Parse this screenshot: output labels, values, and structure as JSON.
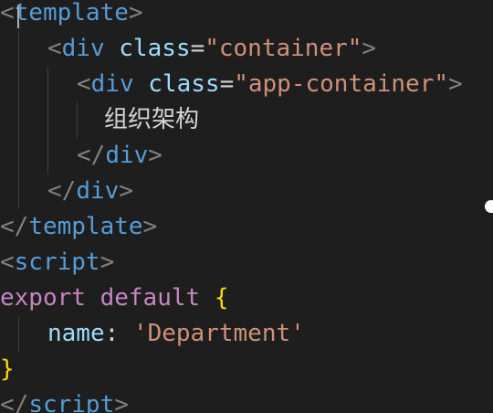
{
  "code": {
    "line0": {
      "open": "<",
      "tag": "template",
      "close": ">"
    },
    "line1": {
      "open": "<",
      "tag": "div",
      "space": " ",
      "attr": "class",
      "eq": "=",
      "value": "\"container\"",
      "close": ">"
    },
    "line2": {
      "open": "<",
      "tag": "div",
      "space": " ",
      "attr": "class",
      "eq": "=",
      "value": "\"app-container\"",
      "close": ">"
    },
    "line3": {
      "text": "组织架构"
    },
    "line4": {
      "open": "</",
      "tag": "div",
      "close": ">"
    },
    "line5": {
      "open": "</",
      "tag": "div",
      "close": ">"
    },
    "line6": {
      "open": "</",
      "tag": "template",
      "close": ">"
    },
    "line7": {
      "open": "<",
      "tag": "script",
      "close": ">"
    },
    "line8": {
      "kw1": "export",
      "space": " ",
      "kw2": "default",
      "space2": " ",
      "brace": "{"
    },
    "line9": {
      "prop": "name",
      "colon": ": ",
      "value": "'Department'"
    },
    "line10": {
      "brace": "}"
    },
    "line11": {
      "open": "</",
      "tag": "script",
      "close": ">"
    }
  },
  "colors": {
    "background": "#1e1e1e",
    "tag": "#569cd6",
    "attribute": "#9cdcfe",
    "string": "#ce9178",
    "keyword": "#c586c0",
    "brace": "#ffd700",
    "bracket": "#808080"
  }
}
